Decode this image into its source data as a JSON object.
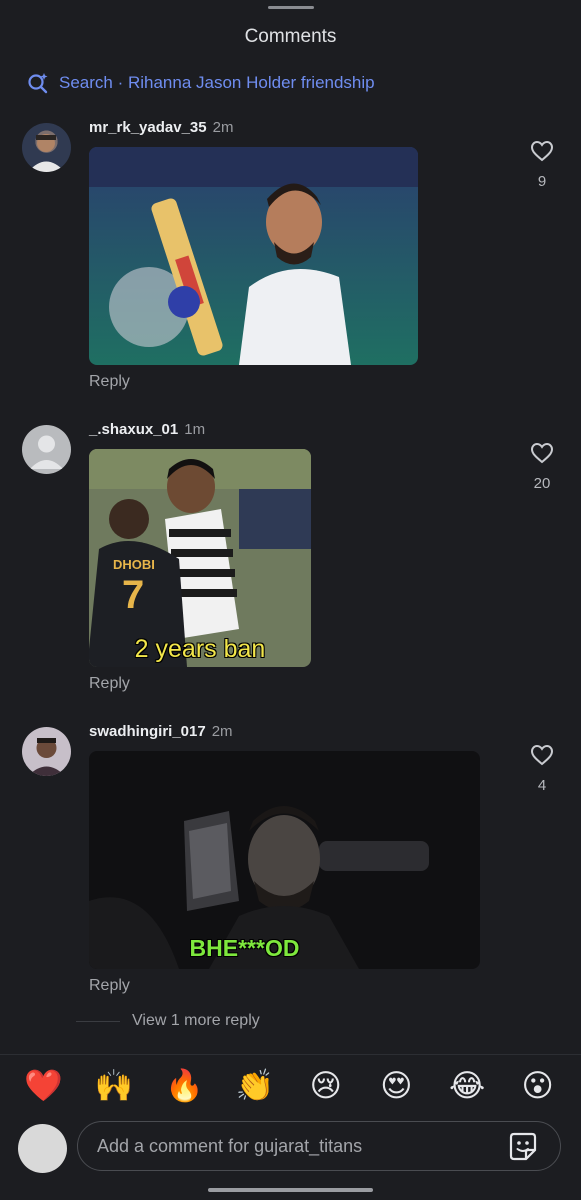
{
  "sheet": {
    "title": "Comments"
  },
  "search": {
    "text": "Search · Rihanna Jason Holder friendship",
    "icon": "search-sparkle-icon",
    "color": "#6f8df0"
  },
  "comments": [
    {
      "username": "mr_rk_yadav_35",
      "time": "2m",
      "likes": "9",
      "reply_label": "Reply",
      "media_caption": ""
    },
    {
      "username": "_.shaxux_01",
      "time": "1m",
      "likes": "20",
      "reply_label": "Reply",
      "media_caption": "2 years ban",
      "jersey_name": "DHOBI",
      "jersey_number": "7"
    },
    {
      "username": "swadhingiri_017",
      "time": "2m",
      "likes": "4",
      "reply_label": "Reply",
      "media_caption": "BHE***OD"
    }
  ],
  "view_more": {
    "label": "View 1 more reply"
  },
  "emoji_bar": [
    "❤️",
    "🙌",
    "🔥",
    "👏",
    "😢",
    "😍",
    "😂",
    "😮"
  ],
  "composer": {
    "placeholder": "Add a comment for gujarat_titans",
    "sticker_icon": "sticker-icon"
  },
  "colors": {
    "background": "#1c1d21",
    "accent": "#6f8df0"
  }
}
